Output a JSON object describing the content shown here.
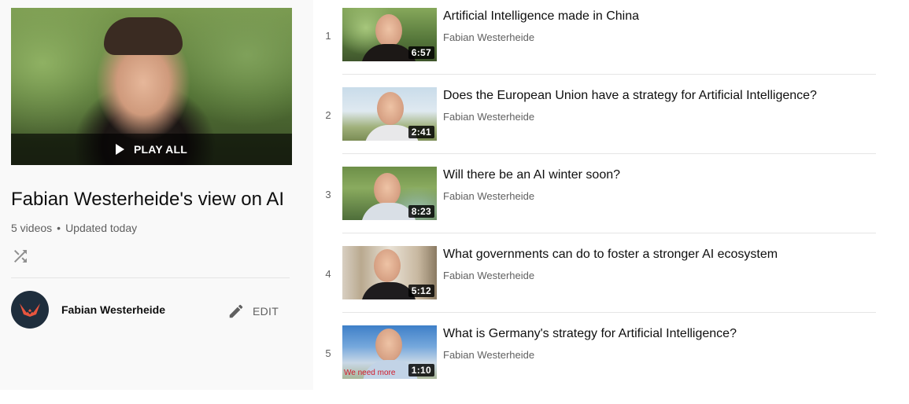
{
  "playlist": {
    "play_all_label": "PLAY ALL",
    "title": "Fabian Westerheide's view on AI",
    "video_count": "5 videos",
    "stats_separator": "•",
    "updated": "Updated today",
    "owner_name": "Fabian Westerheide",
    "edit_label": "EDIT"
  },
  "icons": {
    "play": "play-icon",
    "shuffle": "shuffle-icon",
    "edit": "pencil-icon",
    "avatar": "fox-logo-icon"
  },
  "colors": {
    "sidebar_bg": "#f9f9f9",
    "avatar_bg": "#1f2e3d",
    "avatar_mark": "#e8553e",
    "secondary_text": "#606060"
  },
  "videos": [
    {
      "index": "1",
      "title": "Artificial Intelligence made in China",
      "channel": "Fabian Westerheide",
      "duration": "6:57"
    },
    {
      "index": "2",
      "title": "Does the European Union have a strategy for Artificial Intelligence?",
      "channel": "Fabian Westerheide",
      "duration": "2:41"
    },
    {
      "index": "3",
      "title": "Will there be an AI winter soon?",
      "channel": "Fabian Westerheide",
      "duration": "8:23"
    },
    {
      "index": "4",
      "title": "What governments can do to foster a stronger AI ecosystem",
      "channel": "Fabian Westerheide",
      "duration": "5:12"
    },
    {
      "index": "5",
      "title": "What is Germany's strategy for Artificial Intelligence?",
      "channel": "Fabian Westerheide",
      "duration": "1:10",
      "caption": "We need more"
    }
  ]
}
